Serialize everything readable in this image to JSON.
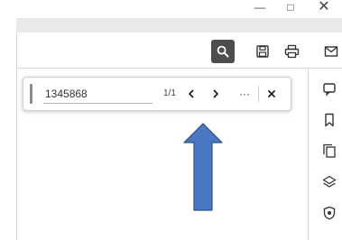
{
  "window": {
    "minimize_glyph": "—",
    "maximize_glyph": "□",
    "close_glyph": "✕"
  },
  "toolbar": {
    "items": [
      {
        "icon": "search-icon",
        "active": true
      },
      {
        "icon": "save-icon"
      },
      {
        "icon": "print-icon"
      },
      {
        "icon": "mail-icon"
      }
    ]
  },
  "find_bar": {
    "query": "1345868",
    "match_count": "1/1",
    "prev_glyph": "‹",
    "next_glyph": "›",
    "more_glyph": "···",
    "close_glyph": "✕"
  },
  "right_sidebar": {
    "items": [
      {
        "icon": "comment-icon"
      },
      {
        "icon": "bookmark-icon"
      },
      {
        "icon": "pages-icon"
      },
      {
        "icon": "layers-icon"
      },
      {
        "icon": "security-icon"
      }
    ]
  },
  "annotation": {
    "arrow_color": "#4a78c2",
    "arrow_outline": "#2e4f86",
    "direction": "up"
  },
  "colors": {
    "active_button": "#4d4d4d",
    "band": "#e9e9e9"
  }
}
